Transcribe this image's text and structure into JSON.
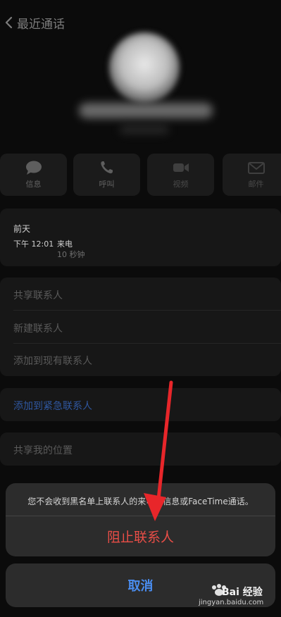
{
  "nav": {
    "back_label": "最近通话"
  },
  "actions": [
    {
      "label": "信息",
      "icon": "message-icon"
    },
    {
      "label": "呼叫",
      "icon": "phone-icon"
    },
    {
      "label": "视频",
      "icon": "video-icon"
    },
    {
      "label": "邮件",
      "icon": "mail-icon"
    }
  ],
  "call_info": {
    "day": "前天",
    "time": "下午 12:01",
    "type": "来电",
    "duration": "10 秒钟"
  },
  "menu": {
    "share_contact": "共享联系人",
    "new_contact": "新建联系人",
    "add_existing": "添加到现有联系人",
    "add_emergency": "添加到紧急联系人",
    "share_location": "共享我的位置"
  },
  "sheet": {
    "message": "您不会收到黑名单上联系人的来电、信息或FaceTime通话。",
    "block_label": "阻止联系人",
    "cancel_label": "取消"
  },
  "watermark": {
    "brand": "Bai 经验",
    "url": "jingyan.baidu.com"
  },
  "colors": {
    "block_red": "#ea4e47",
    "cancel_blue": "#4a8df0",
    "emergency_blue": "#2f57a0",
    "arrow_red": "#e8262a"
  }
}
